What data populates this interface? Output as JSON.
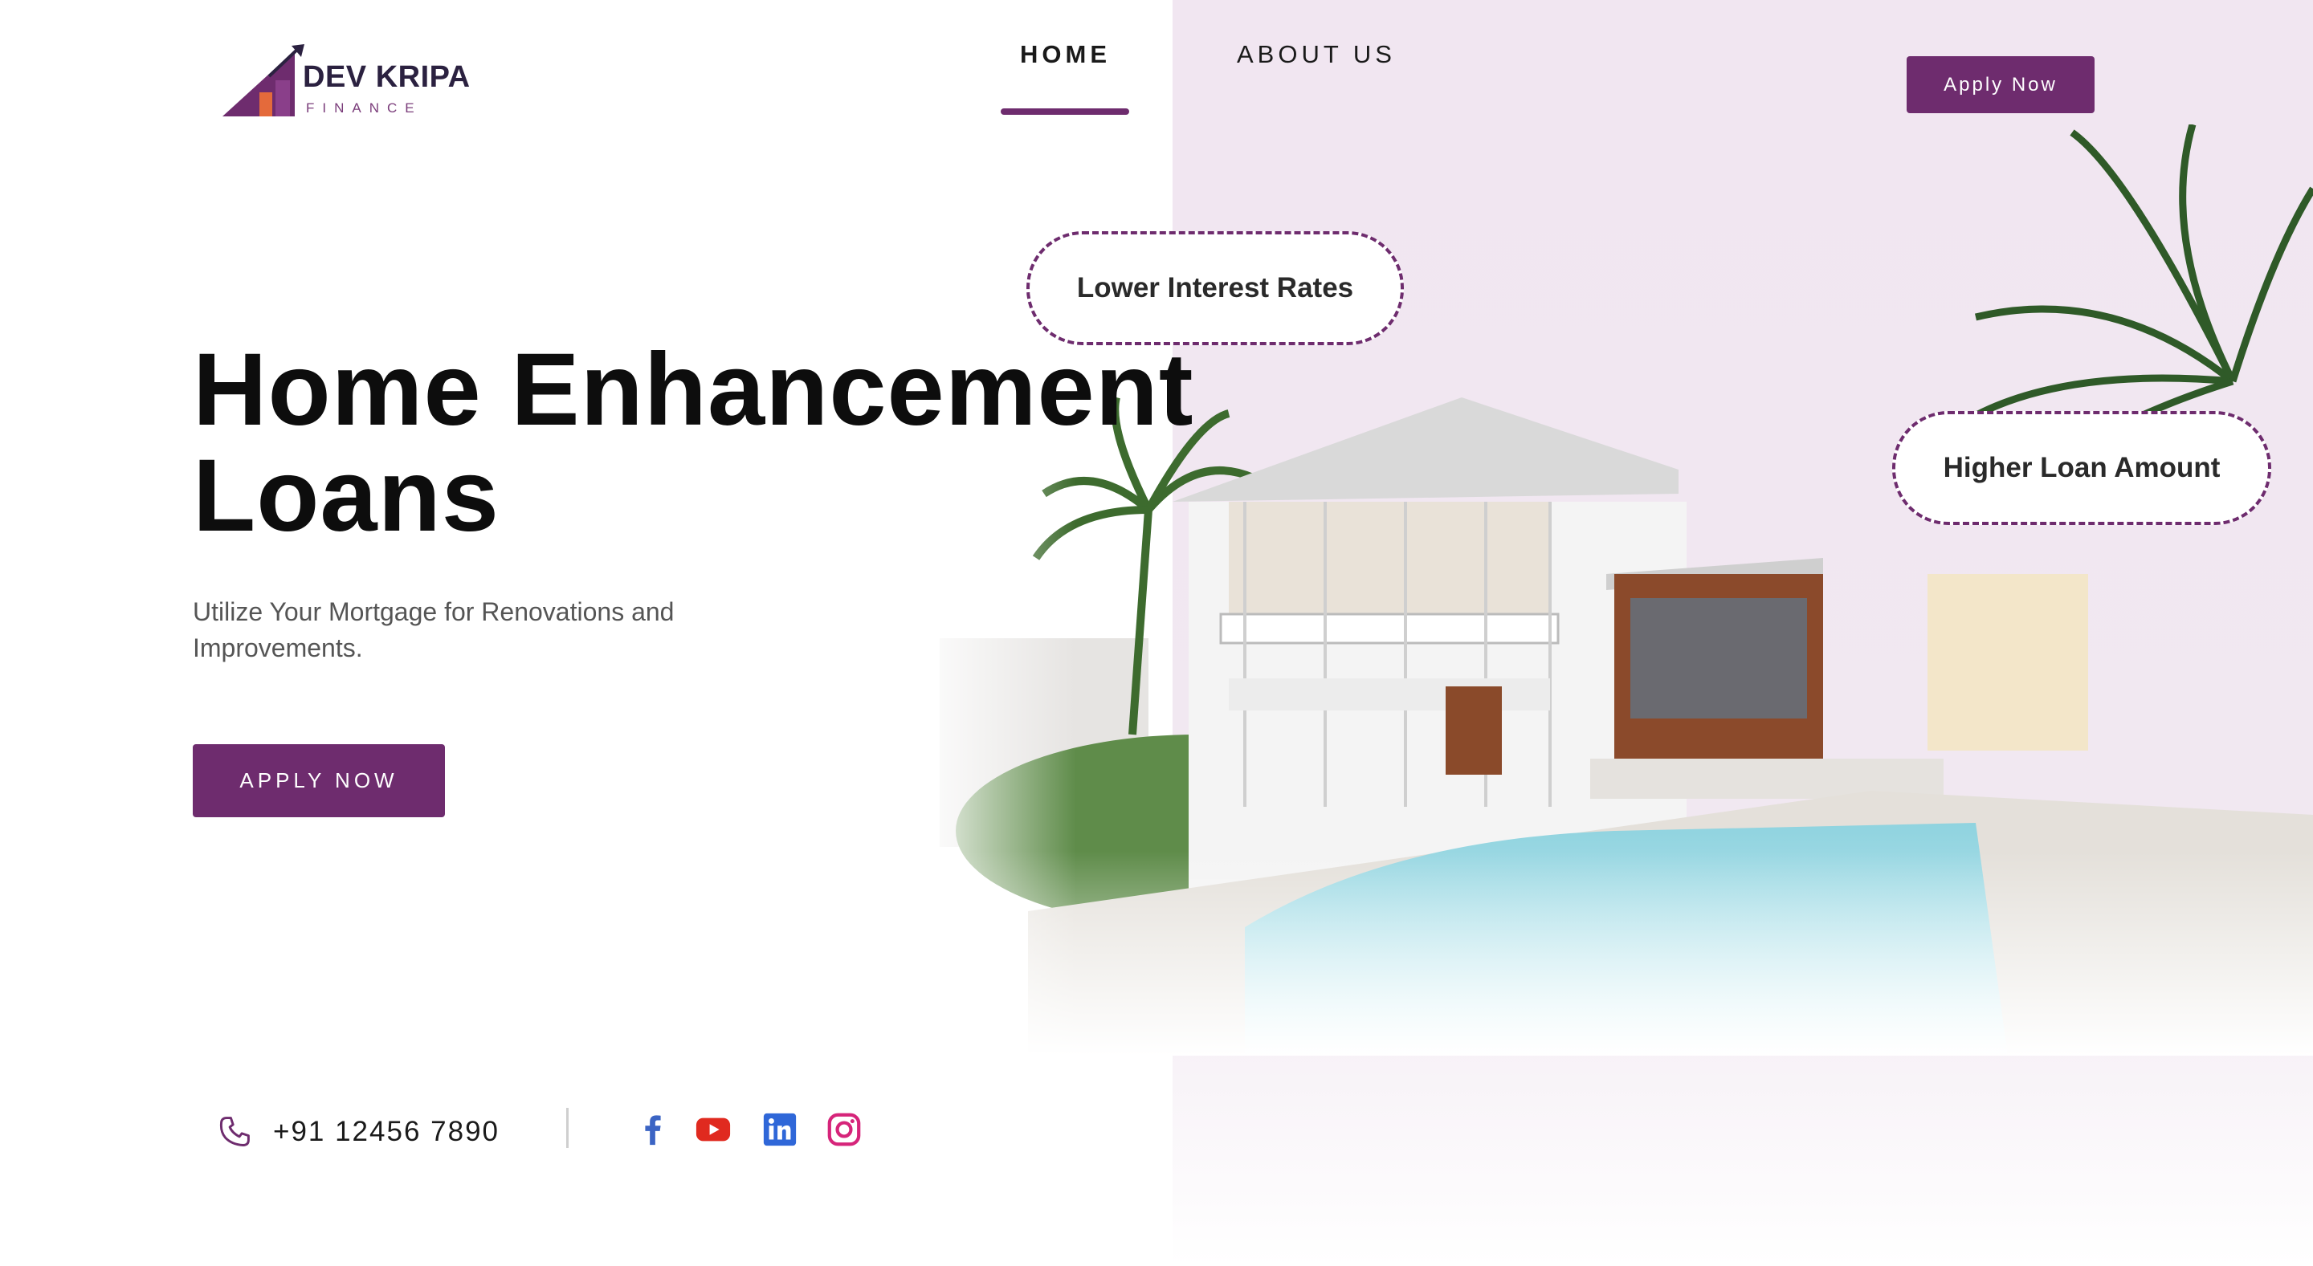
{
  "brand": {
    "name": "DEV KRIPA",
    "tagline": "FINANCE"
  },
  "nav": {
    "items": [
      {
        "label": "HOME",
        "active": true
      },
      {
        "label": "ABOUT US",
        "active": false
      }
    ]
  },
  "header": {
    "cta_label": "Apply Now"
  },
  "hero": {
    "title_line1": "Home Enhancement",
    "title_line2": "Loans",
    "subtitle": "Utilize Your Mortgage for Renovations and Improvements.",
    "cta_label": "APPLY NOW"
  },
  "badges": {
    "rates": "Lower Interest Rates",
    "loan": "Higher Loan Amount"
  },
  "contact": {
    "phone": "+91 12456 7890"
  },
  "social": [
    "facebook-icon",
    "youtube-icon",
    "linkedin-icon",
    "instagram-icon"
  ],
  "colors": {
    "accent": "#6e2c6e",
    "panel": "#f1e6f1"
  }
}
